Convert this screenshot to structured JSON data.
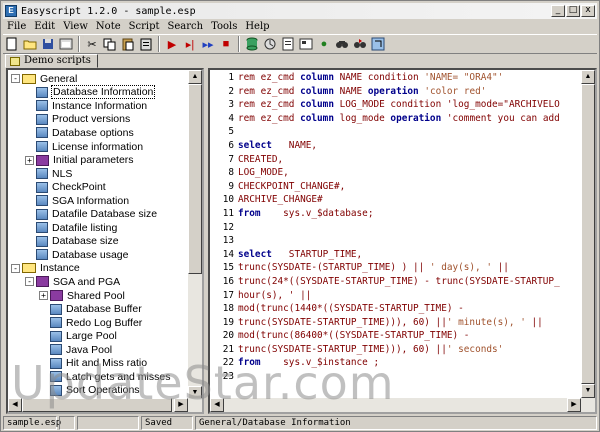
{
  "window": {
    "title": "Easyscript 1.2.0 - sample.esp",
    "controls": [
      "_",
      "□",
      "x"
    ]
  },
  "menu": [
    "File",
    "Edit",
    "View",
    "Note",
    "Script",
    "Search",
    "Tools",
    "Help"
  ],
  "toolbar": {
    "icons": [
      "new-icon",
      "open-icon",
      "save-icon",
      "properties-icon",
      "cut-icon",
      "copy-icon",
      "paste-icon",
      "clipboard-icon",
      "run-icon",
      "step-icon",
      "run-all-icon",
      "stop-icon",
      "database-icon",
      "connect-icon",
      "script-icon",
      "document-icon",
      "execute-icon",
      "binoculars-icon",
      "find-next-icon",
      "replace-icon"
    ]
  },
  "tab": {
    "label": "Demo scripts"
  },
  "tree": [
    {
      "label": "General",
      "type": "folder",
      "level": 0,
      "expander": "-"
    },
    {
      "label": "Database Information",
      "type": "leaf",
      "level": 1,
      "selected": true
    },
    {
      "label": "Instance Information",
      "type": "leaf",
      "level": 1
    },
    {
      "label": "Product versions",
      "type": "leaf",
      "level": 1
    },
    {
      "label": "Database options",
      "type": "leaf",
      "level": 1
    },
    {
      "label": "License information",
      "type": "leaf",
      "level": 1
    },
    {
      "label": "Initial parameters",
      "type": "book",
      "level": 1,
      "expander": "+"
    },
    {
      "label": "NLS",
      "type": "leaf",
      "level": 1
    },
    {
      "label": "CheckPoint",
      "type": "leaf",
      "level": 1
    },
    {
      "label": "SGA Information",
      "type": "leaf",
      "level": 1
    },
    {
      "label": "Datafile Database size",
      "type": "leaf",
      "level": 1
    },
    {
      "label": "Datafile listing",
      "type": "leaf",
      "level": 1
    },
    {
      "label": "Database size",
      "type": "leaf",
      "level": 1
    },
    {
      "label": "Database usage",
      "type": "leaf",
      "level": 1
    },
    {
      "label": "Instance",
      "type": "folder",
      "level": 0,
      "expander": "-"
    },
    {
      "label": "SGA and PGA",
      "type": "book",
      "level": 1,
      "expander": "-"
    },
    {
      "label": "Shared Pool",
      "type": "book",
      "level": 2,
      "expander": "+"
    },
    {
      "label": "Database Buffer",
      "type": "leaf",
      "level": 2
    },
    {
      "label": "Redo Log Buffer",
      "type": "leaf",
      "level": 2
    },
    {
      "label": "Large Pool",
      "type": "leaf",
      "level": 2
    },
    {
      "label": "Java Pool",
      "type": "leaf",
      "level": 2
    },
    {
      "label": "Hit and Miss ratio",
      "type": "leaf",
      "level": 2
    },
    {
      "label": "Latch gets and misses",
      "type": "leaf",
      "level": 2
    },
    {
      "label": "Sort Operations",
      "type": "leaf",
      "level": 2
    }
  ],
  "code_lines": [
    {
      "n": "1",
      "text": "rem ez_cmd column NAME condition 'NAME= \"ORA4\"'"
    },
    {
      "n": "2",
      "text": "rem ez_cmd column NAME operation 'color red'"
    },
    {
      "n": "3",
      "text": "rem ez_cmd column LOG_MODE condition 'log_mode=\"ARCHIVELO"
    },
    {
      "n": "4",
      "text": "rem ez_cmd column log_mode operation 'comment you can add"
    },
    {
      "n": "5",
      "text": ""
    },
    {
      "n": "6",
      "text": "select   NAME,"
    },
    {
      "n": "7",
      "text": "CREATED,"
    },
    {
      "n": "8",
      "text": "LOG_MODE,"
    },
    {
      "n": "9",
      "text": "CHECKPOINT_CHANGE#,"
    },
    {
      "n": "10",
      "text": "ARCHIVE_CHANGE#"
    },
    {
      "n": "11",
      "text": "from    sys.v_$database;"
    },
    {
      "n": "12",
      "text": ""
    },
    {
      "n": "13",
      "text": ""
    },
    {
      "n": "14",
      "text": "select   STARTUP_TIME,"
    },
    {
      "n": "15",
      "text": "trunc(SYSDATE-(STARTUP_TIME) ) || ' day(s), ' ||"
    },
    {
      "n": "16",
      "text": "trunc(24*((SYSDATE-STARTUP_TIME) - trunc(SYSDATE-STARTUP_"
    },
    {
      "n": "17",
      "text": "hour(s), ' ||"
    },
    {
      "n": "18",
      "text": "mod(trunc(1440*((SYSDATE-STARTUP_TIME) -"
    },
    {
      "n": "19",
      "text": "trunc(SYSDATE-STARTUP_TIME))), 60) ||' minute(s), ' ||"
    },
    {
      "n": "20",
      "text": "mod(trunc(86400*((SYSDATE-STARTUP_TIME) -"
    },
    {
      "n": "21",
      "text": "trunc(SYSDATE-STARTUP_TIME))), 60) ||' seconds'"
    },
    {
      "n": "22",
      "text": "from    sys.v_$instance ;"
    },
    {
      "n": "23",
      "text": ""
    }
  ],
  "status": {
    "file": "sample.esp",
    "state": "Saved",
    "path": "General/Database Information"
  },
  "watermark": "UpdateStar.com"
}
